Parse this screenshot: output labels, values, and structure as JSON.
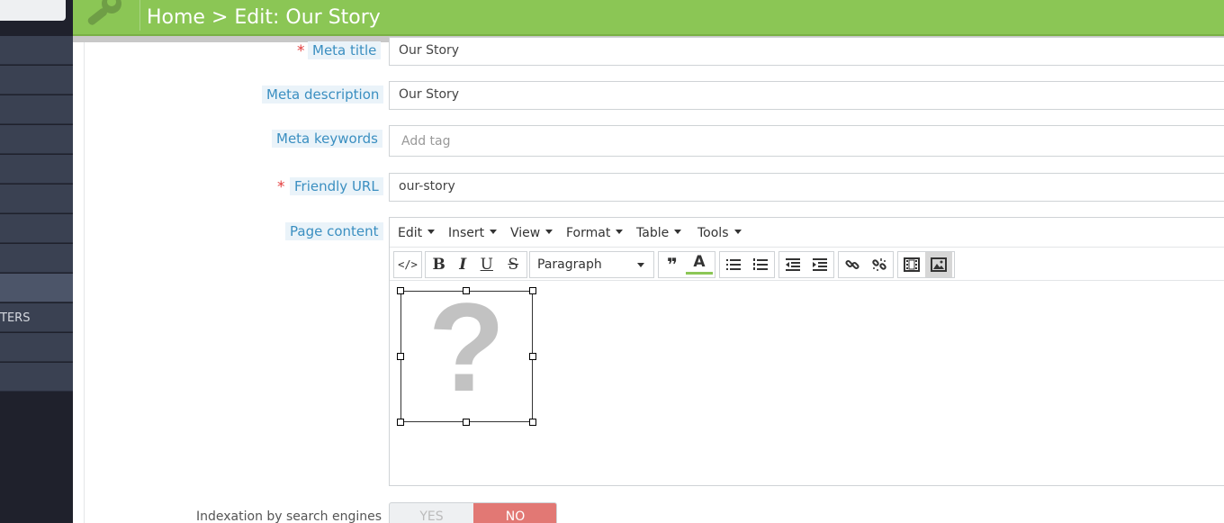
{
  "header": {
    "breadcrumb": "Home > Edit: Our Story",
    "icon": "wrench-icon"
  },
  "sidebar": {
    "partial_label": "TERS"
  },
  "form": {
    "meta_title": {
      "label": "Meta title",
      "value": "Our Story",
      "required": true
    },
    "meta_description": {
      "label": "Meta description",
      "value": "Our Story"
    },
    "meta_keywords": {
      "label": "Meta keywords",
      "placeholder": "Add tag"
    },
    "friendly_url": {
      "label": "Friendly URL",
      "value": "our-story",
      "required": true
    },
    "page_content": {
      "label": "Page content"
    },
    "required_marker": "*"
  },
  "editor": {
    "menus": [
      "Edit",
      "Insert",
      "View",
      "Format",
      "Table",
      "Tools"
    ],
    "format_select": "Paragraph",
    "placeholder_glyph": "?"
  },
  "indexation": {
    "label": "Indexation by search engines",
    "yes": "YES",
    "no": "NO",
    "selected": "NO"
  },
  "colors": {
    "header_green": "#8bc655",
    "label_blue": "#3b8fc1",
    "no_red": "#e27874",
    "sidebar_dark": "#1f212c"
  }
}
